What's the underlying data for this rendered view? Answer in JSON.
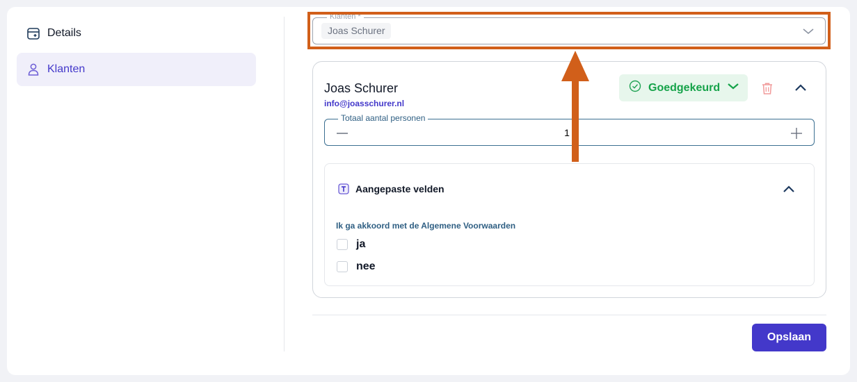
{
  "sidebar": {
    "items": [
      {
        "label": "Details",
        "icon": "calendar-plus-icon",
        "active": false
      },
      {
        "label": "Klanten",
        "icon": "user-icon",
        "active": true
      }
    ]
  },
  "customer_select": {
    "label": "Klanten *",
    "selected": "Joas Schurer",
    "icon": "chevron-down-icon"
  },
  "client": {
    "name": "Joas Schurer",
    "email": "info@joasschurer.nl",
    "status": "Goedgekeurd",
    "status_color": "#16a34a",
    "total_persons_label": "Totaal aantal personen",
    "total_persons_value": "1"
  },
  "custom_fields": {
    "title": "Aangepaste velden",
    "terms_label": "Ik ga akkoord met de Algemene Voorwaarden",
    "options": [
      "ja",
      "nee"
    ]
  },
  "actions": {
    "save_label": "Opslaan"
  },
  "colors": {
    "accent": "#4338ca",
    "highlight": "#d15f1a",
    "success": "#16a34a"
  }
}
